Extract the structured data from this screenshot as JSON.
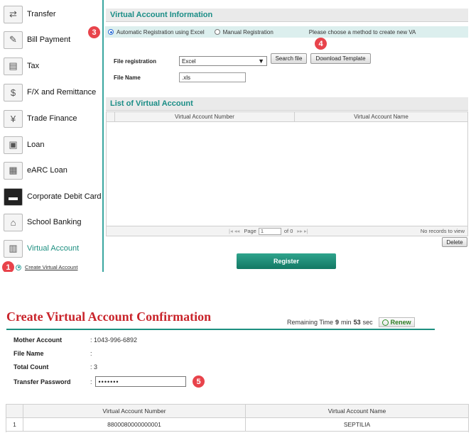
{
  "sidebar": {
    "items": [
      {
        "label": "Transfer",
        "icon": "transfer-icon",
        "glyph": "⇄"
      },
      {
        "label": "Bill Payment",
        "icon": "bill-payment-icon",
        "glyph": "✎"
      },
      {
        "label": "Tax",
        "icon": "tax-icon",
        "glyph": "▤"
      },
      {
        "label": "F/X and Remittance",
        "icon": "fx-remittance-icon",
        "glyph": "$"
      },
      {
        "label": "Trade Finance",
        "icon": "trade-finance-icon",
        "glyph": "¥"
      },
      {
        "label": "Loan",
        "icon": "loan-icon",
        "glyph": "▣"
      },
      {
        "label": "eARC Loan",
        "icon": "earc-loan-icon",
        "glyph": "▦"
      },
      {
        "label": "Corporate Debit Card",
        "icon": "debit-card-icon",
        "glyph": "▬"
      },
      {
        "label": "School Banking",
        "icon": "school-banking-icon",
        "glyph": "⌂"
      },
      {
        "label": "Virtual Account",
        "icon": "virtual-account-icon",
        "glyph": "▥"
      }
    ],
    "sub_item": "Create Virtual Account"
  },
  "badges": [
    "1",
    "3",
    "4",
    "5"
  ],
  "va_info": {
    "title": "Virtual Account Information",
    "option_excel": "Automatic Registration using Excel",
    "option_manual": "Manual Registration",
    "hint": "Please choose a method to create new VA",
    "file_registration_label": "File registration",
    "file_registration_value": "Excel",
    "search_button": "Search file",
    "template_button": "Download Template",
    "file_name_label": "File Name",
    "file_name_value": ".xls"
  },
  "va_list": {
    "title": "List of Virtual Account",
    "columns": [
      "Virtual Account Number",
      "Virtual Account Name"
    ],
    "pager_page_label": "Page",
    "pager_page_value": "1",
    "pager_of": "of 0",
    "no_records": "No records to view",
    "delete_button": "Delete",
    "register_button": "Register"
  },
  "confirmation": {
    "title": "Create Virtual Account Confirmation",
    "remaining_label": "Remaining Time",
    "minutes": "9",
    "min_label": "min",
    "seconds": "53",
    "sec_label": "sec",
    "renew_button": "Renew",
    "fields": [
      {
        "label": "Mother Account",
        "value": ": 1043-996-6892"
      },
      {
        "label": "File Name",
        "value": ":"
      },
      {
        "label": "Total Count",
        "value": ": 3"
      }
    ],
    "password_label": "Transfer Password",
    "password_value": "•••••••",
    "table_columns": [
      "Virtual Account Number",
      "Virtual Account Name"
    ],
    "rows": [
      {
        "no": "1",
        "number": "8800080000000001",
        "name": "SEPTILIA"
      }
    ]
  },
  "colors": {
    "accent": "#1c8f80",
    "badge": "#e8434b",
    "title_red": "#c9252c"
  }
}
